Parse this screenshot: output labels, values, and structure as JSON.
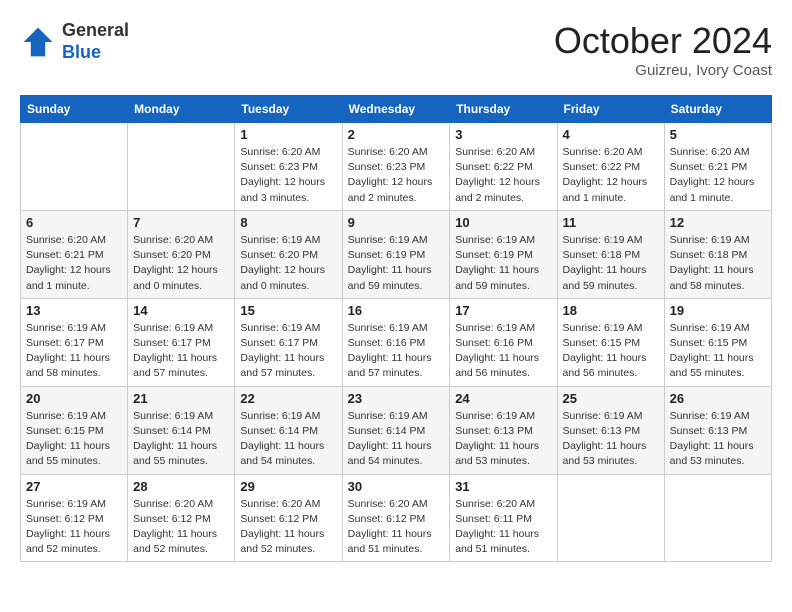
{
  "header": {
    "logo_general": "General",
    "logo_blue": "Blue",
    "month": "October 2024",
    "location": "Guizreu, Ivory Coast"
  },
  "days_of_week": [
    "Sunday",
    "Monday",
    "Tuesday",
    "Wednesday",
    "Thursday",
    "Friday",
    "Saturday"
  ],
  "weeks": [
    [
      {
        "day": "",
        "info": ""
      },
      {
        "day": "",
        "info": ""
      },
      {
        "day": "1",
        "info": "Sunrise: 6:20 AM\nSunset: 6:23 PM\nDaylight: 12 hours\nand 3 minutes."
      },
      {
        "day": "2",
        "info": "Sunrise: 6:20 AM\nSunset: 6:23 PM\nDaylight: 12 hours\nand 2 minutes."
      },
      {
        "day": "3",
        "info": "Sunrise: 6:20 AM\nSunset: 6:22 PM\nDaylight: 12 hours\nand 2 minutes."
      },
      {
        "day": "4",
        "info": "Sunrise: 6:20 AM\nSunset: 6:22 PM\nDaylight: 12 hours\nand 1 minute."
      },
      {
        "day": "5",
        "info": "Sunrise: 6:20 AM\nSunset: 6:21 PM\nDaylight: 12 hours\nand 1 minute."
      }
    ],
    [
      {
        "day": "6",
        "info": "Sunrise: 6:20 AM\nSunset: 6:21 PM\nDaylight: 12 hours\nand 1 minute."
      },
      {
        "day": "7",
        "info": "Sunrise: 6:20 AM\nSunset: 6:20 PM\nDaylight: 12 hours\nand 0 minutes."
      },
      {
        "day": "8",
        "info": "Sunrise: 6:19 AM\nSunset: 6:20 PM\nDaylight: 12 hours\nand 0 minutes."
      },
      {
        "day": "9",
        "info": "Sunrise: 6:19 AM\nSunset: 6:19 PM\nDaylight: 11 hours\nand 59 minutes."
      },
      {
        "day": "10",
        "info": "Sunrise: 6:19 AM\nSunset: 6:19 PM\nDaylight: 11 hours\nand 59 minutes."
      },
      {
        "day": "11",
        "info": "Sunrise: 6:19 AM\nSunset: 6:18 PM\nDaylight: 11 hours\nand 59 minutes."
      },
      {
        "day": "12",
        "info": "Sunrise: 6:19 AM\nSunset: 6:18 PM\nDaylight: 11 hours\nand 58 minutes."
      }
    ],
    [
      {
        "day": "13",
        "info": "Sunrise: 6:19 AM\nSunset: 6:17 PM\nDaylight: 11 hours\nand 58 minutes."
      },
      {
        "day": "14",
        "info": "Sunrise: 6:19 AM\nSunset: 6:17 PM\nDaylight: 11 hours\nand 57 minutes."
      },
      {
        "day": "15",
        "info": "Sunrise: 6:19 AM\nSunset: 6:17 PM\nDaylight: 11 hours\nand 57 minutes."
      },
      {
        "day": "16",
        "info": "Sunrise: 6:19 AM\nSunset: 6:16 PM\nDaylight: 11 hours\nand 57 minutes."
      },
      {
        "day": "17",
        "info": "Sunrise: 6:19 AM\nSunset: 6:16 PM\nDaylight: 11 hours\nand 56 minutes."
      },
      {
        "day": "18",
        "info": "Sunrise: 6:19 AM\nSunset: 6:15 PM\nDaylight: 11 hours\nand 56 minutes."
      },
      {
        "day": "19",
        "info": "Sunrise: 6:19 AM\nSunset: 6:15 PM\nDaylight: 11 hours\nand 55 minutes."
      }
    ],
    [
      {
        "day": "20",
        "info": "Sunrise: 6:19 AM\nSunset: 6:15 PM\nDaylight: 11 hours\nand 55 minutes."
      },
      {
        "day": "21",
        "info": "Sunrise: 6:19 AM\nSunset: 6:14 PM\nDaylight: 11 hours\nand 55 minutes."
      },
      {
        "day": "22",
        "info": "Sunrise: 6:19 AM\nSunset: 6:14 PM\nDaylight: 11 hours\nand 54 minutes."
      },
      {
        "day": "23",
        "info": "Sunrise: 6:19 AM\nSunset: 6:14 PM\nDaylight: 11 hours\nand 54 minutes."
      },
      {
        "day": "24",
        "info": "Sunrise: 6:19 AM\nSunset: 6:13 PM\nDaylight: 11 hours\nand 53 minutes."
      },
      {
        "day": "25",
        "info": "Sunrise: 6:19 AM\nSunset: 6:13 PM\nDaylight: 11 hours\nand 53 minutes."
      },
      {
        "day": "26",
        "info": "Sunrise: 6:19 AM\nSunset: 6:13 PM\nDaylight: 11 hours\nand 53 minutes."
      }
    ],
    [
      {
        "day": "27",
        "info": "Sunrise: 6:19 AM\nSunset: 6:12 PM\nDaylight: 11 hours\nand 52 minutes."
      },
      {
        "day": "28",
        "info": "Sunrise: 6:20 AM\nSunset: 6:12 PM\nDaylight: 11 hours\nand 52 minutes."
      },
      {
        "day": "29",
        "info": "Sunrise: 6:20 AM\nSunset: 6:12 PM\nDaylight: 11 hours\nand 52 minutes."
      },
      {
        "day": "30",
        "info": "Sunrise: 6:20 AM\nSunset: 6:12 PM\nDaylight: 11 hours\nand 51 minutes."
      },
      {
        "day": "31",
        "info": "Sunrise: 6:20 AM\nSunset: 6:11 PM\nDaylight: 11 hours\nand 51 minutes."
      },
      {
        "day": "",
        "info": ""
      },
      {
        "day": "",
        "info": ""
      }
    ]
  ]
}
